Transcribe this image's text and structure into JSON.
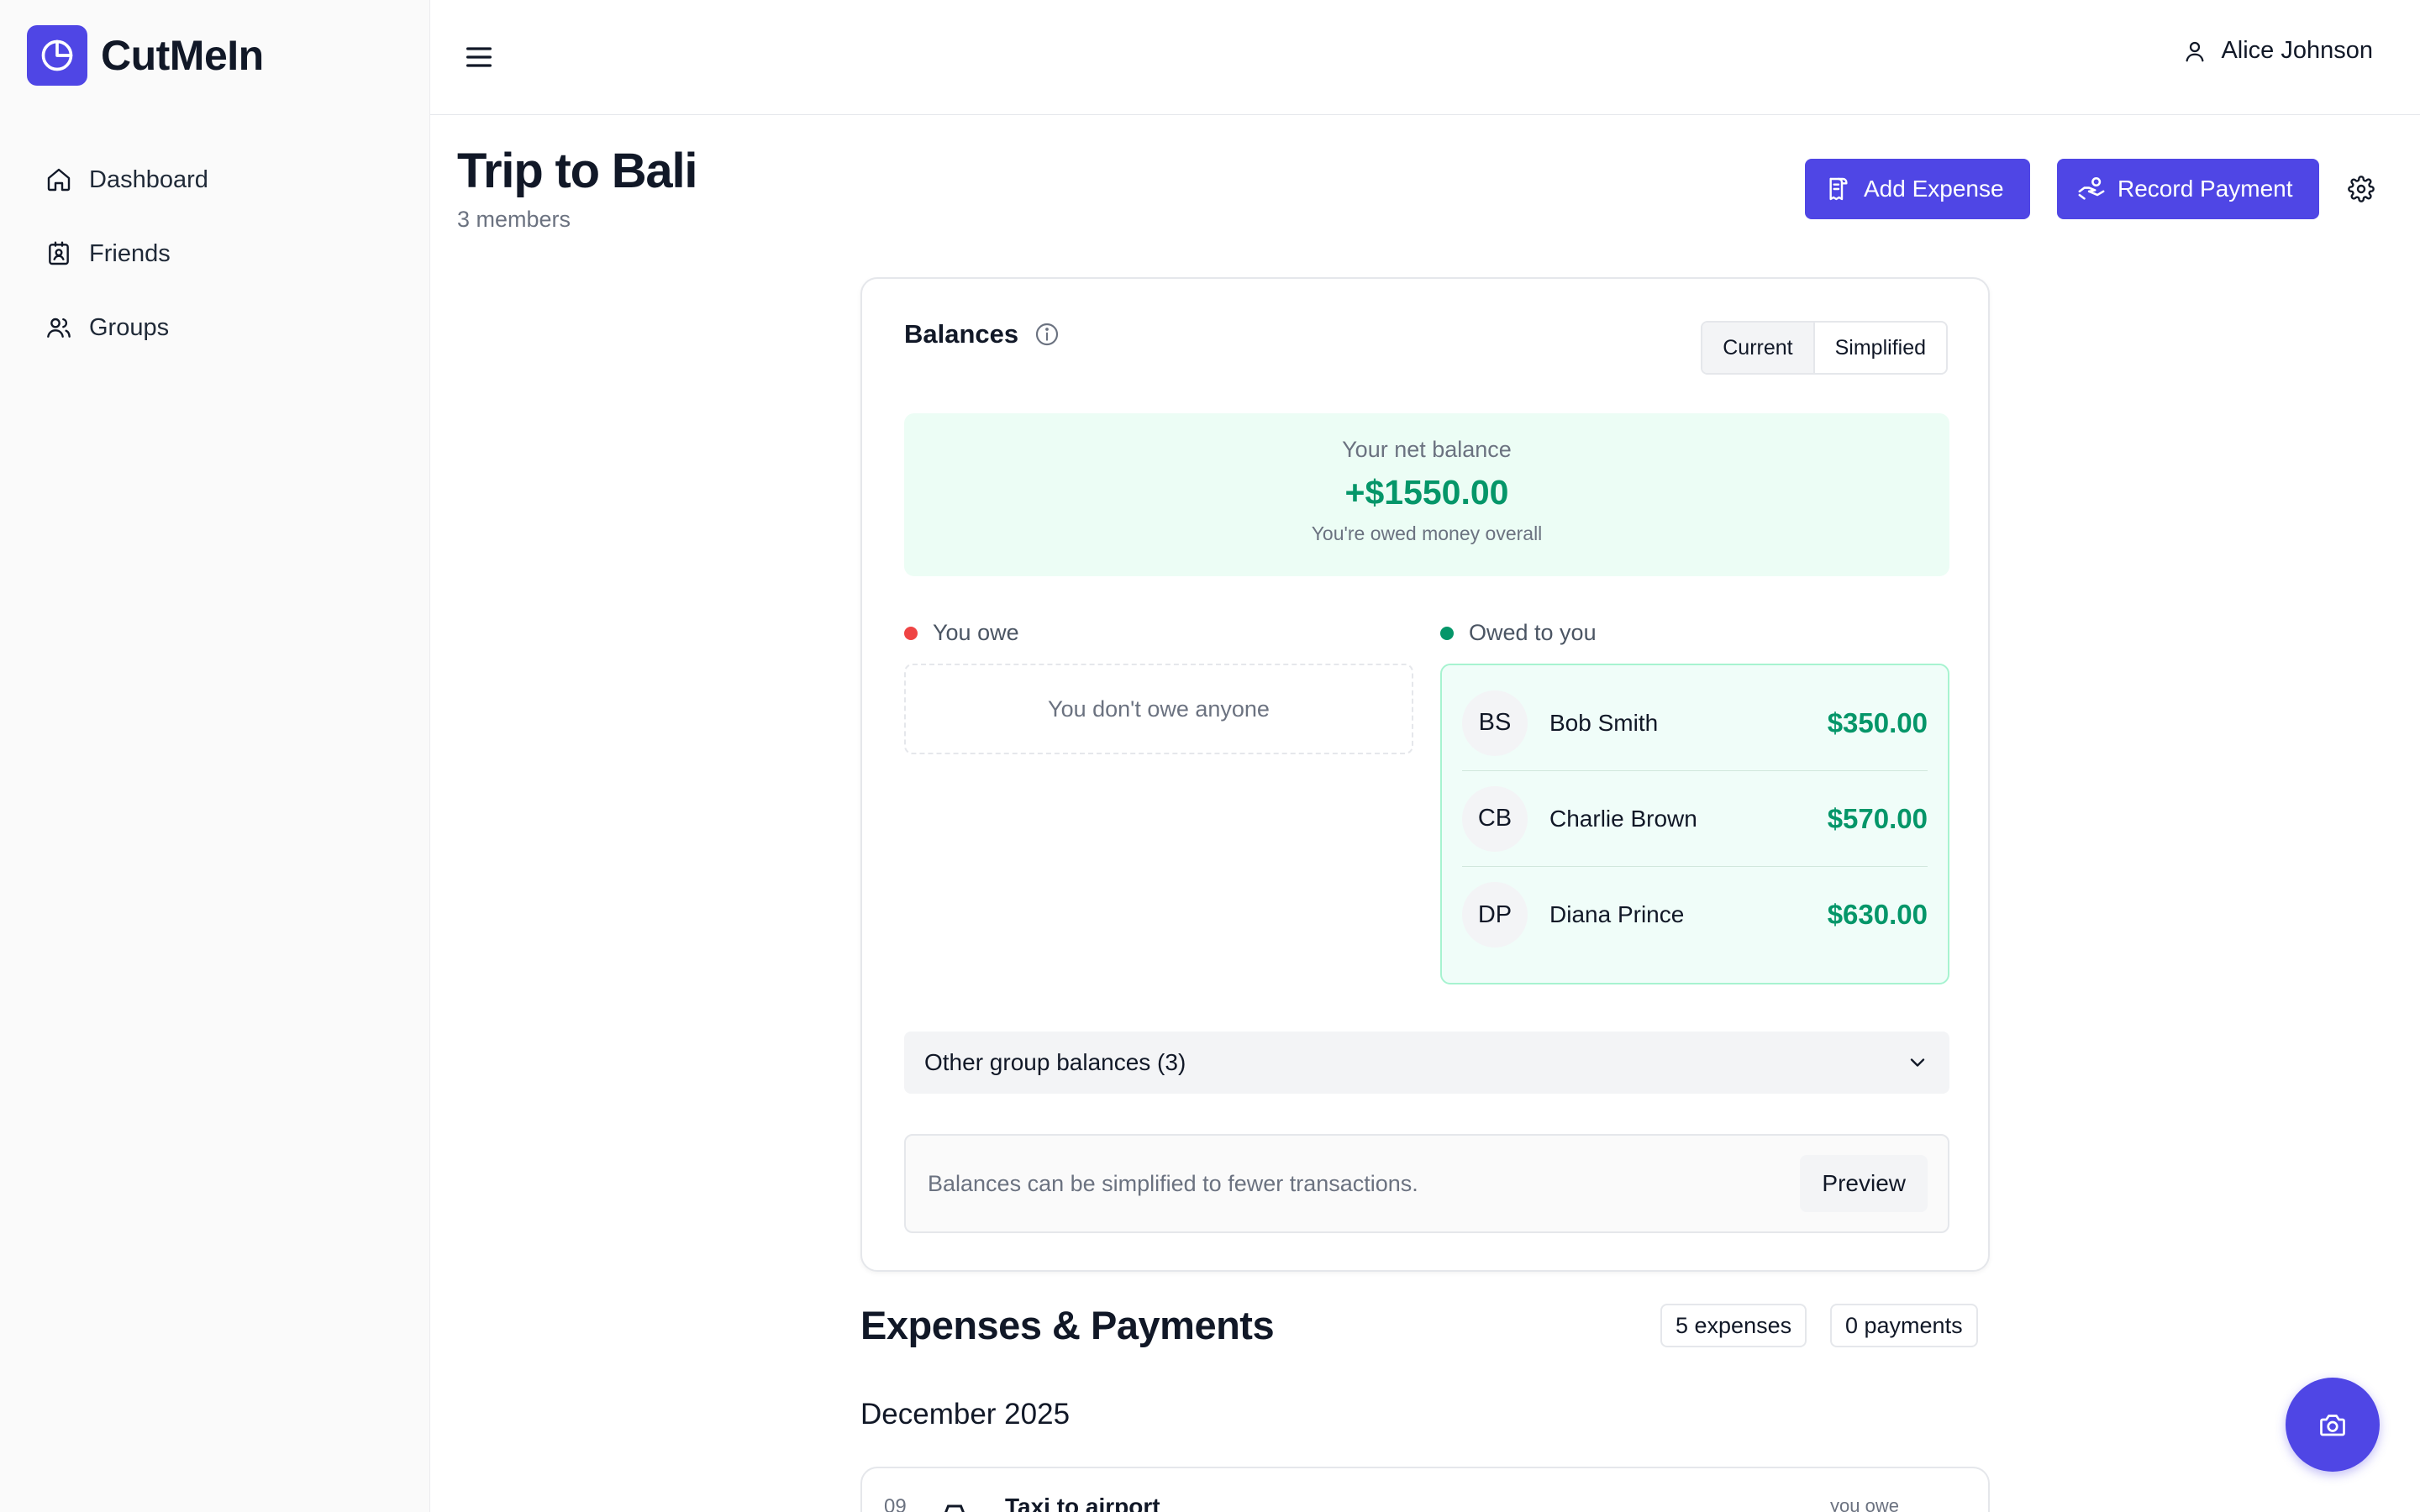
{
  "app": {
    "name": "CutMeIn",
    "brand_color": "#4f46e5"
  },
  "sidebar": {
    "items": [
      {
        "label": "Dashboard",
        "icon": "home-icon"
      },
      {
        "label": "Friends",
        "icon": "contact-icon"
      },
      {
        "label": "Groups",
        "icon": "users-icon"
      }
    ]
  },
  "topbar": {
    "user_name": "Alice Johnson"
  },
  "page": {
    "title": "Trip to Bali",
    "subtitle": "3 members",
    "add_expense_label": "Add Expense",
    "record_payment_label": "Record Payment"
  },
  "balances": {
    "title": "Balances",
    "toggle": {
      "current": "Current",
      "simplified": "Simplified",
      "selected": "Current"
    },
    "net": {
      "label": "Your net balance",
      "amount": "+$1550.00",
      "note": "You're owed money overall",
      "color": "#059669"
    },
    "you_owe": {
      "label": "You owe",
      "empty_text": "You don't owe anyone",
      "dot_color": "#ef4444"
    },
    "owed_to_you": {
      "label": "Owed to you",
      "dot_color": "#059669",
      "items": [
        {
          "initials": "BS",
          "name": "Bob Smith",
          "amount": "$350.00"
        },
        {
          "initials": "CB",
          "name": "Charlie Brown",
          "amount": "$570.00"
        },
        {
          "initials": "DP",
          "name": "Diana Prince",
          "amount": "$630.00"
        }
      ]
    },
    "other_group": "Other group balances (3)",
    "simplify": {
      "text": "Balances can be simplified to fewer transactions.",
      "button": "Preview"
    }
  },
  "expenses": {
    "title": "Expenses & Payments",
    "expenses_count": "5 expenses",
    "payments_count": "0 payments",
    "month": "December 2025",
    "items": [
      {
        "day": "09",
        "name": "Taxi to airport",
        "status": "you owe"
      }
    ]
  }
}
